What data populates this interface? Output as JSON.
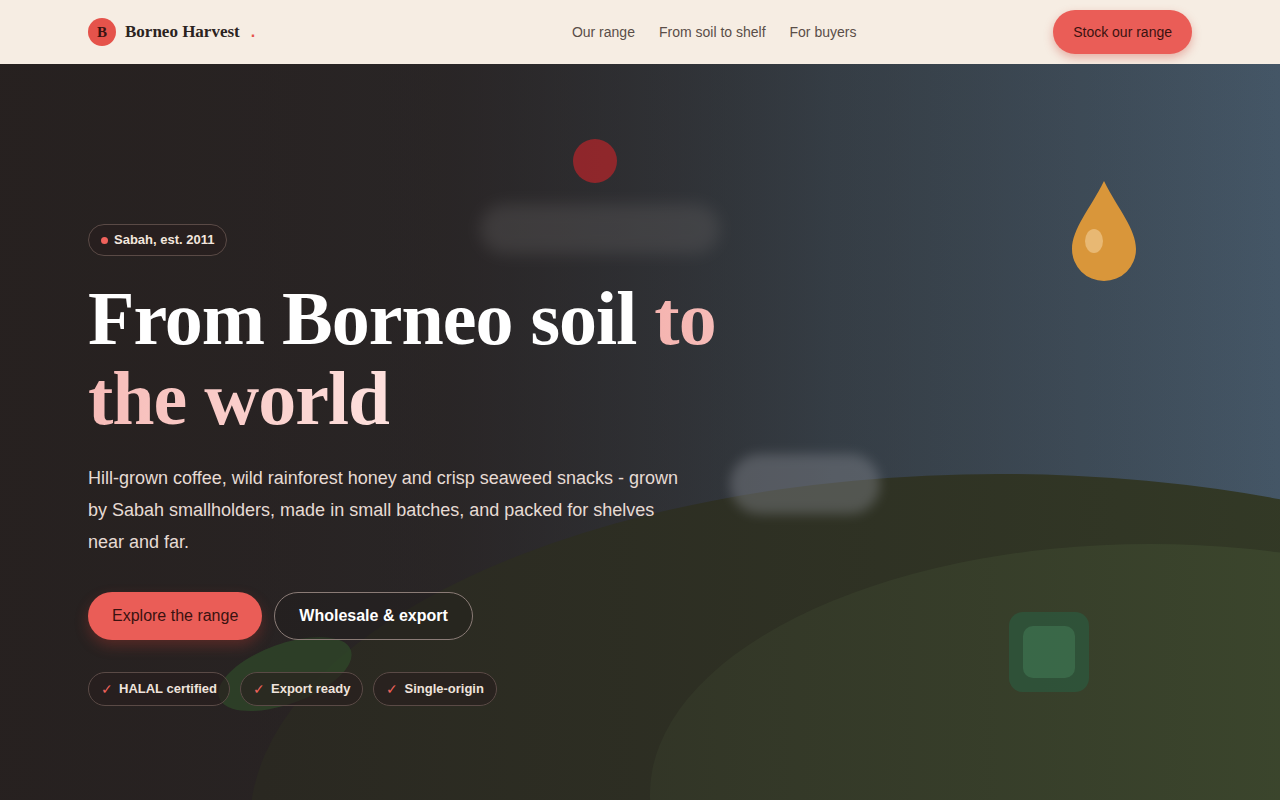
{
  "nav": {
    "logo_letter": "B",
    "brand": "Borneo Harvest",
    "brand_dot": ".",
    "links": [
      "Our range",
      "From soil to shelf",
      "For buyers"
    ],
    "cta": "Stock our range"
  },
  "hero": {
    "badge": "Sabah, est. 2011",
    "title_plain": "From Borneo soil",
    "title_accent": "to the world",
    "description": "Hill-grown coffee, wild rainforest honey and crisp seaweed snacks - grown by Sabah smallholders, made in small batches, and packed for shelves near and far.",
    "buttons": [
      {
        "label": "Explore the range",
        "kind": "primary"
      },
      {
        "label": "Wholesale & export",
        "kind": "outline"
      }
    ],
    "chips": [
      {
        "icon": "✓",
        "label": "HALAL certified"
      },
      {
        "icon": "✓",
        "label": "Export ready"
      },
      {
        "icon": "✓",
        "label": "Single-origin"
      }
    ]
  }
}
